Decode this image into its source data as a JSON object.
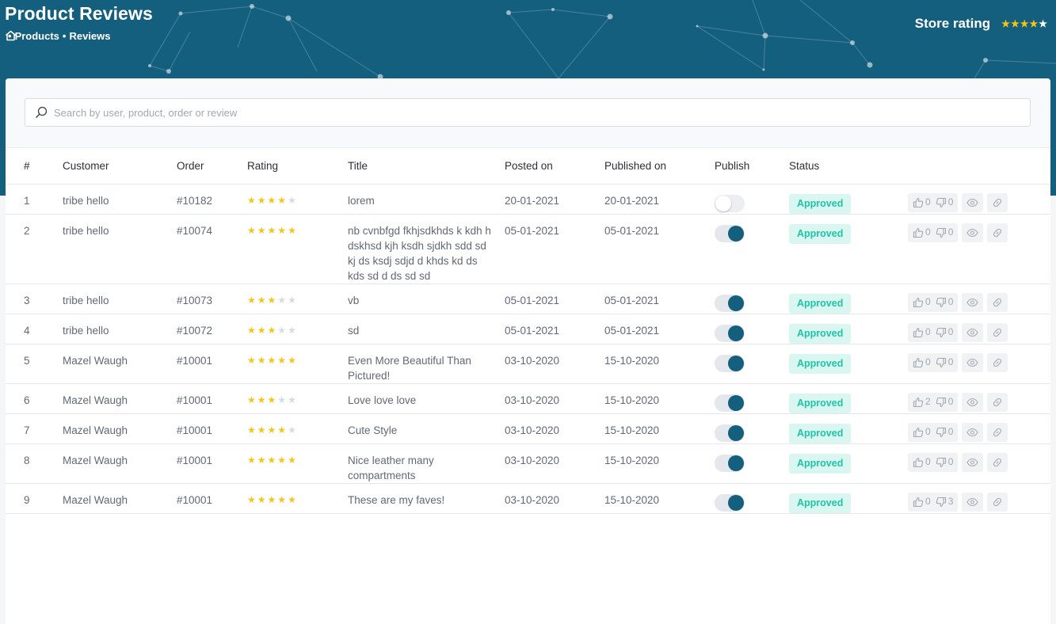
{
  "header": {
    "title": "Product Reviews",
    "breadcrumb": [
      "Products",
      "Reviews"
    ],
    "store_rating_label": "Store rating",
    "store_rating_stars": 4
  },
  "search": {
    "placeholder": "Search by user, product, order or review"
  },
  "table": {
    "columns": [
      "#",
      "Customer",
      "Order",
      "Rating",
      "Title",
      "Posted on",
      "Published on",
      "Publish",
      "Status"
    ],
    "rows": [
      {
        "num": "1",
        "customer": "tribe hello",
        "order": "#10182",
        "rating": 4,
        "title": "lorem",
        "posted": "20-01-2021",
        "published": "20-01-2021",
        "publish": false,
        "status": "Approved",
        "likes": "0",
        "dislikes": "0"
      },
      {
        "num": "2",
        "customer": "tribe hello",
        "order": "#10074",
        "rating": 5,
        "title": "nb cvnbfgd fkhjsdkhds k kdh h dskhsd kjh ksdh sjdkh sdd sd kj ds ksdj sdjd d khds kd ds kds sd d ds sd sd",
        "posted": "05-01-2021",
        "published": "05-01-2021",
        "publish": true,
        "status": "Approved",
        "likes": "0",
        "dislikes": "0"
      },
      {
        "num": "3",
        "customer": "tribe hello",
        "order": "#10073",
        "rating": 3,
        "title": "vb",
        "posted": "05-01-2021",
        "published": "05-01-2021",
        "publish": true,
        "status": "Approved",
        "likes": "0",
        "dislikes": "0"
      },
      {
        "num": "4",
        "customer": "tribe hello",
        "order": "#10072",
        "rating": 3,
        "title": "sd",
        "posted": "05-01-2021",
        "published": "05-01-2021",
        "publish": true,
        "status": "Approved",
        "likes": "0",
        "dislikes": "0"
      },
      {
        "num": "5",
        "customer": "Mazel Waugh",
        "order": "#10001",
        "rating": 5,
        "title": "Even More Beautiful Than Pictured!",
        "posted": "03-10-2020",
        "published": "15-10-2020",
        "publish": true,
        "status": "Approved",
        "likes": "0",
        "dislikes": "0"
      },
      {
        "num": "6",
        "customer": "Mazel Waugh",
        "order": "#10001",
        "rating": 3,
        "title": "Love love love",
        "posted": "03-10-2020",
        "published": "15-10-2020",
        "publish": true,
        "status": "Approved",
        "likes": "2",
        "dislikes": "0"
      },
      {
        "num": "7",
        "customer": "Mazel Waugh",
        "order": "#10001",
        "rating": 4,
        "title": "Cute Style",
        "posted": "03-10-2020",
        "published": "15-10-2020",
        "publish": true,
        "status": "Approved",
        "likes": "0",
        "dislikes": "0"
      },
      {
        "num": "8",
        "customer": "Mazel Waugh",
        "order": "#10001",
        "rating": 5,
        "title": "Nice leather many compartments",
        "posted": "03-10-2020",
        "published": "15-10-2020",
        "publish": true,
        "status": "Approved",
        "likes": "0",
        "dislikes": "0"
      },
      {
        "num": "9",
        "customer": "Mazel Waugh",
        "order": "#10001",
        "rating": 5,
        "title": "These are my faves!",
        "posted": "03-10-2020",
        "published": "15-10-2020",
        "publish": true,
        "status": "Approved",
        "likes": "0",
        "dislikes": "3"
      }
    ]
  },
  "colors": {
    "header_bg": "#155f7e",
    "accent": "#155f7e",
    "star": "#f5c518",
    "badge_bg": "#d9f6f1",
    "badge_text": "#1fc4a6"
  },
  "icons": {
    "home": "home-icon",
    "search": "search-icon",
    "like": "thumbs-up-icon",
    "dislike": "thumbs-down-icon",
    "view": "eye-icon",
    "link": "link-icon"
  }
}
